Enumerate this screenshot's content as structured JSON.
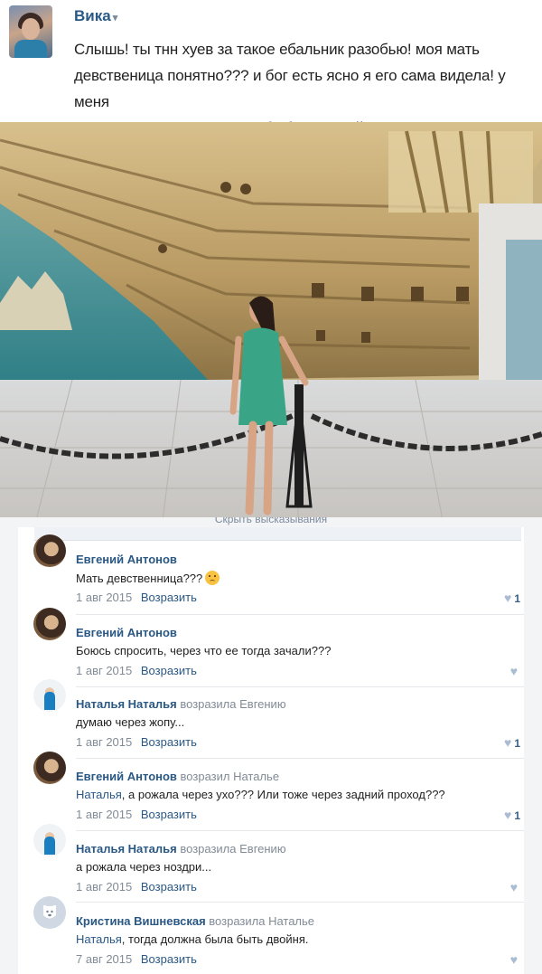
{
  "post": {
    "author": "Вика",
    "author_caret": "▾",
    "text_line1": "Слышь! ты тнн хуев за такое ебальник разобью! моя мать",
    "text_line2": "девственица понятно??? и бог есть ясно я его сама видела! у меня",
    "text_line3": "мама админ вкантакте я тебя быстра найду",
    "hide_comments_link": "Скрыть высказывания"
  },
  "comments": [
    {
      "author": "Евгений Антонов",
      "reply_to": "",
      "text": "Мать девственница???",
      "has_emoji": true,
      "date": "1 авг 2015",
      "reply_label": "Возразить",
      "likes": "1",
      "avatar": "ev"
    },
    {
      "author": "Евгений Антонов",
      "reply_to": "",
      "text": "Боюсь спросить, через что ее тогда зачали???",
      "has_emoji": false,
      "date": "1 авг 2015",
      "reply_label": "Возразить",
      "likes": "",
      "avatar": "ev"
    },
    {
      "author": "Наталья Наталья",
      "reply_to": "возразила Евгению",
      "text": "думаю через жопу...",
      "has_emoji": false,
      "date": "1 авг 2015",
      "reply_label": "Возразить",
      "likes": "1",
      "avatar": "nat"
    },
    {
      "author": "Евгений Антонов",
      "reply_to": "возразил Наталье",
      "text_link": "Наталья",
      "text": ", а рожала через ухо??? Или тоже через задний проход???",
      "has_emoji": false,
      "date": "1 авг 2015",
      "reply_label": "Возразить",
      "likes": "1",
      "avatar": "ev"
    },
    {
      "author": "Наталья Наталья",
      "reply_to": "возразила Евгению",
      "text": "а рожала через ноздри...",
      "has_emoji": false,
      "date": "1 авг 2015",
      "reply_label": "Возразить",
      "likes": "",
      "avatar": "nat"
    },
    {
      "author": "Кристина Вишневская",
      "reply_to": "возразила Наталье",
      "text_link": "Наталья",
      "text": ", тогда должна была быть двойня.",
      "has_emoji": false,
      "date": "7 авг 2015",
      "reply_label": "Возразить",
      "likes": "",
      "avatar": "kr"
    }
  ],
  "colors": {
    "link": "#2a5885",
    "meta": "#828b96",
    "heart": "#a9bcd2"
  },
  "icons": {
    "like": "heart-icon",
    "emoji": "sad-face-emoji-icon"
  }
}
